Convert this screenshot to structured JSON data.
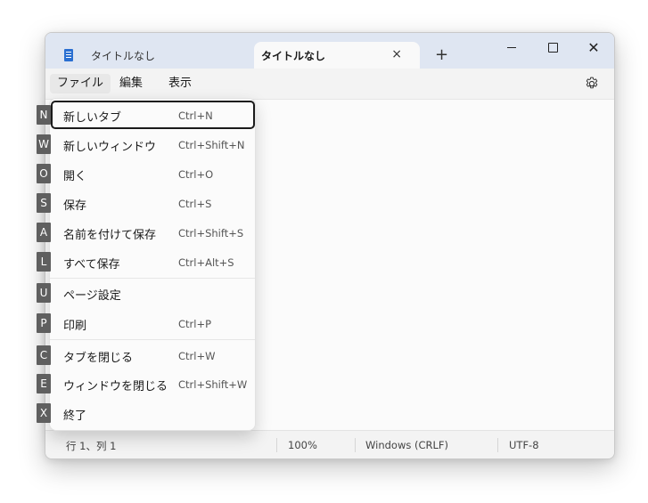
{
  "titlebar": {
    "tabs": [
      {
        "title": "タイトルなし",
        "icon": "notepad-icon"
      },
      {
        "title": "タイトルなし",
        "close_icon": "×"
      }
    ],
    "new_tab_icon": "+",
    "minimize_icon": "minimize-icon",
    "maximize_icon": "maximize-icon",
    "close_icon": "✕"
  },
  "menubar": {
    "file": "ファイル",
    "edit": "編集",
    "view": "表示",
    "settings_icon": "gear-icon"
  },
  "file_menu": {
    "items": [
      {
        "key": "N",
        "label": "新しいタブ",
        "shortcut": "Ctrl+N"
      },
      {
        "key": "W",
        "label": "新しいウィンドウ",
        "shortcut": "Ctrl+Shift+N"
      },
      {
        "key": "O",
        "label": "開く",
        "shortcut": "Ctrl+O"
      },
      {
        "key": "S",
        "label": "保存",
        "shortcut": "Ctrl+S"
      },
      {
        "key": "A",
        "label": "名前を付けて保存",
        "shortcut": "Ctrl+Shift+S"
      },
      {
        "key": "L",
        "label": "すべて保存",
        "shortcut": "Ctrl+Alt+S"
      },
      {
        "key": "U",
        "label": "ページ設定",
        "shortcut": ""
      },
      {
        "key": "P",
        "label": "印刷",
        "shortcut": "Ctrl+P"
      },
      {
        "key": "C",
        "label": "タブを閉じる",
        "shortcut": "Ctrl+W"
      },
      {
        "key": "E",
        "label": "ウィンドウを閉じる",
        "shortcut": "Ctrl+Shift+W"
      },
      {
        "key": "X",
        "label": "終了",
        "shortcut": ""
      }
    ]
  },
  "statusbar": {
    "position": "行 1、列 1",
    "zoom": "100%",
    "line_ending": "Windows (CRLF)",
    "encoding": "UTF-8"
  }
}
